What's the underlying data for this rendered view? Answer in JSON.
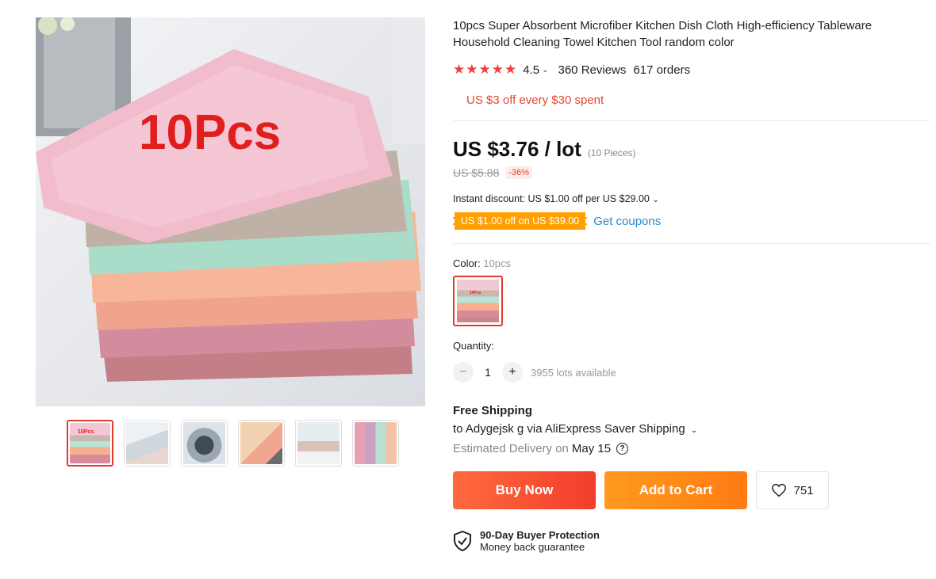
{
  "product": {
    "image_overlay_text": "10Pcs",
    "title": "10pcs Super Absorbent Microfiber Kitchen Dish Cloth High-efficiency Tableware Household Cleaning Towel Kitchen Tool random color",
    "rating": "4.5",
    "reviews": "360 Reviews",
    "orders": "617 orders",
    "promo": "US $3 off every $30 spent",
    "price": "US $3.76 / lot",
    "pieces": "(10 Pieces)",
    "original_price": "US $5.88",
    "discount": "-36%",
    "instant_discount": "Instant discount: US $1.00 off per US $29.00",
    "coupon": "US $1.00 off on US $39.00",
    "get_coupons": "Get coupons",
    "color_label": "Color:",
    "color_value": "10pcs",
    "swatch_text": "10Pcs",
    "quantity_label": "Quantity:",
    "quantity": "1",
    "availability": "3955 lots available"
  },
  "thumbnails": [
    {
      "label": "10Pcs"
    },
    {
      "label": ""
    },
    {
      "label": ""
    },
    {
      "label": ""
    },
    {
      "label": ""
    },
    {
      "label": ""
    }
  ],
  "shipping": {
    "title": "Free Shipping",
    "to": "to Adygejsk g via AliExpress Saver Shipping",
    "delivery_label": "Estimated Delivery on",
    "delivery_date": "May 15"
  },
  "actions": {
    "buy_now": "Buy Now",
    "add_to_cart": "Add to Cart",
    "wishlist_count": "751"
  },
  "protection": {
    "title": "90-Day Buyer Protection",
    "subtitle": "Money back guarantee"
  },
  "colors": {
    "accent_red": "#f23d2c",
    "accent_orange": "#ff9a1f",
    "link_blue": "#2a8dc4",
    "star": "#f03e3e"
  }
}
